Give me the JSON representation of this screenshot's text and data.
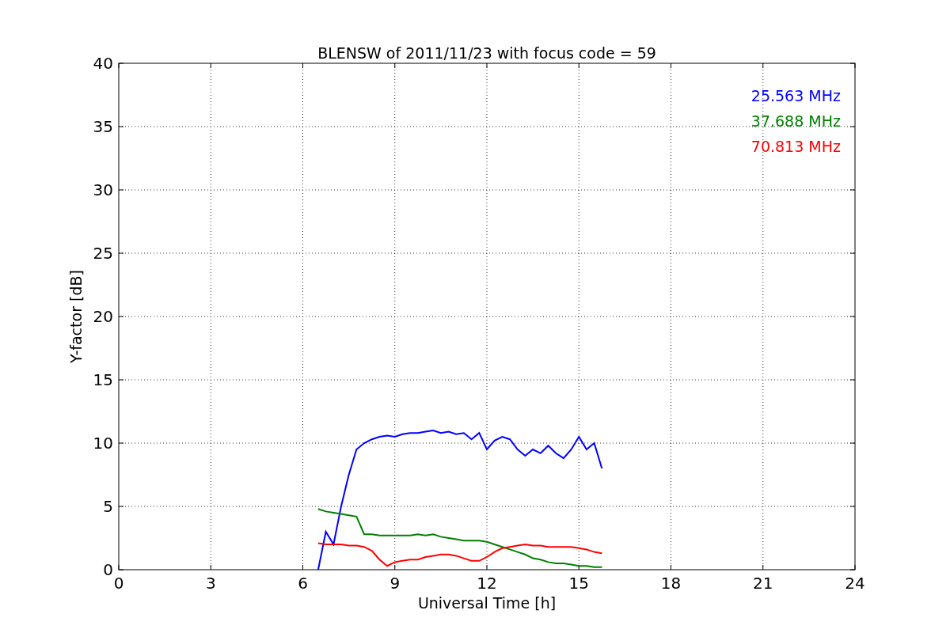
{
  "figure": {
    "chart_data": {
      "type": "line",
      "title": "BLENSW of 2011/11/23 with focus code = 59",
      "xlabel": "Universal Time [h]",
      "ylabel": "Y-factor [dB]",
      "x": [
        6.5,
        6.75,
        7,
        7.25,
        7.5,
        7.75,
        8,
        8.25,
        8.5,
        8.75,
        9,
        9.25,
        9.5,
        9.75,
        10,
        10.25,
        10.5,
        10.75,
        11,
        11.25,
        11.5,
        11.75,
        12,
        12.25,
        12.5,
        12.75,
        13,
        13.25,
        13.5,
        13.75,
        14,
        14.25,
        14.5,
        14.75,
        15,
        15.25,
        15.5,
        15.75
      ],
      "series": [
        {
          "name": "25.563 MHz",
          "color": "#0000ff",
          "values": [
            0,
            3,
            2,
            5,
            7.5,
            9.5,
            10,
            10.3,
            10.5,
            10.6,
            10.5,
            10.7,
            10.8,
            10.8,
            10.9,
            11,
            10.8,
            10.9,
            10.7,
            10.8,
            10.3,
            10.8,
            9.5,
            10.2,
            10.5,
            10.3,
            9.5,
            9,
            9.5,
            9.2,
            9.8,
            9.2,
            8.8,
            9.5,
            10.5,
            9.5,
            10,
            8
          ]
        },
        {
          "name": "37.688 MHz",
          "color": "#008000",
          "values": [
            4.8,
            4.6,
            4.5,
            4.4,
            4.3,
            4.2,
            2.8,
            2.8,
            2.7,
            2.7,
            2.7,
            2.7,
            2.7,
            2.8,
            2.7,
            2.8,
            2.6,
            2.5,
            2.4,
            2.3,
            2.3,
            2.3,
            2.2,
            2,
            1.8,
            1.6,
            1.4,
            1.2,
            0.9,
            0.8,
            0.6,
            0.5,
            0.5,
            0.4,
            0.3,
            0.3,
            0.2,
            0.2
          ]
        },
        {
          "name": "70.813 MHz",
          "color": "#ff0000",
          "values": [
            2.1,
            2,
            2,
            2,
            1.9,
            1.9,
            1.8,
            1.5,
            0.8,
            0.3,
            0.6,
            0.7,
            0.8,
            0.8,
            1,
            1.1,
            1.2,
            1.2,
            1.1,
            0.9,
            0.7,
            0.7,
            1,
            1.4,
            1.7,
            1.8,
            1.9,
            2,
            1.9,
            1.9,
            1.8,
            1.8,
            1.8,
            1.8,
            1.7,
            1.6,
            1.4,
            1.3
          ]
        }
      ],
      "grid": true,
      "xlim": [
        0,
        24
      ],
      "ylim": [
        0,
        40
      ],
      "xticks": [
        0,
        3,
        6,
        9,
        12,
        15,
        18,
        21,
        24
      ],
      "yticks": [
        0,
        5,
        10,
        15,
        20,
        25,
        30,
        35,
        40
      ]
    }
  }
}
